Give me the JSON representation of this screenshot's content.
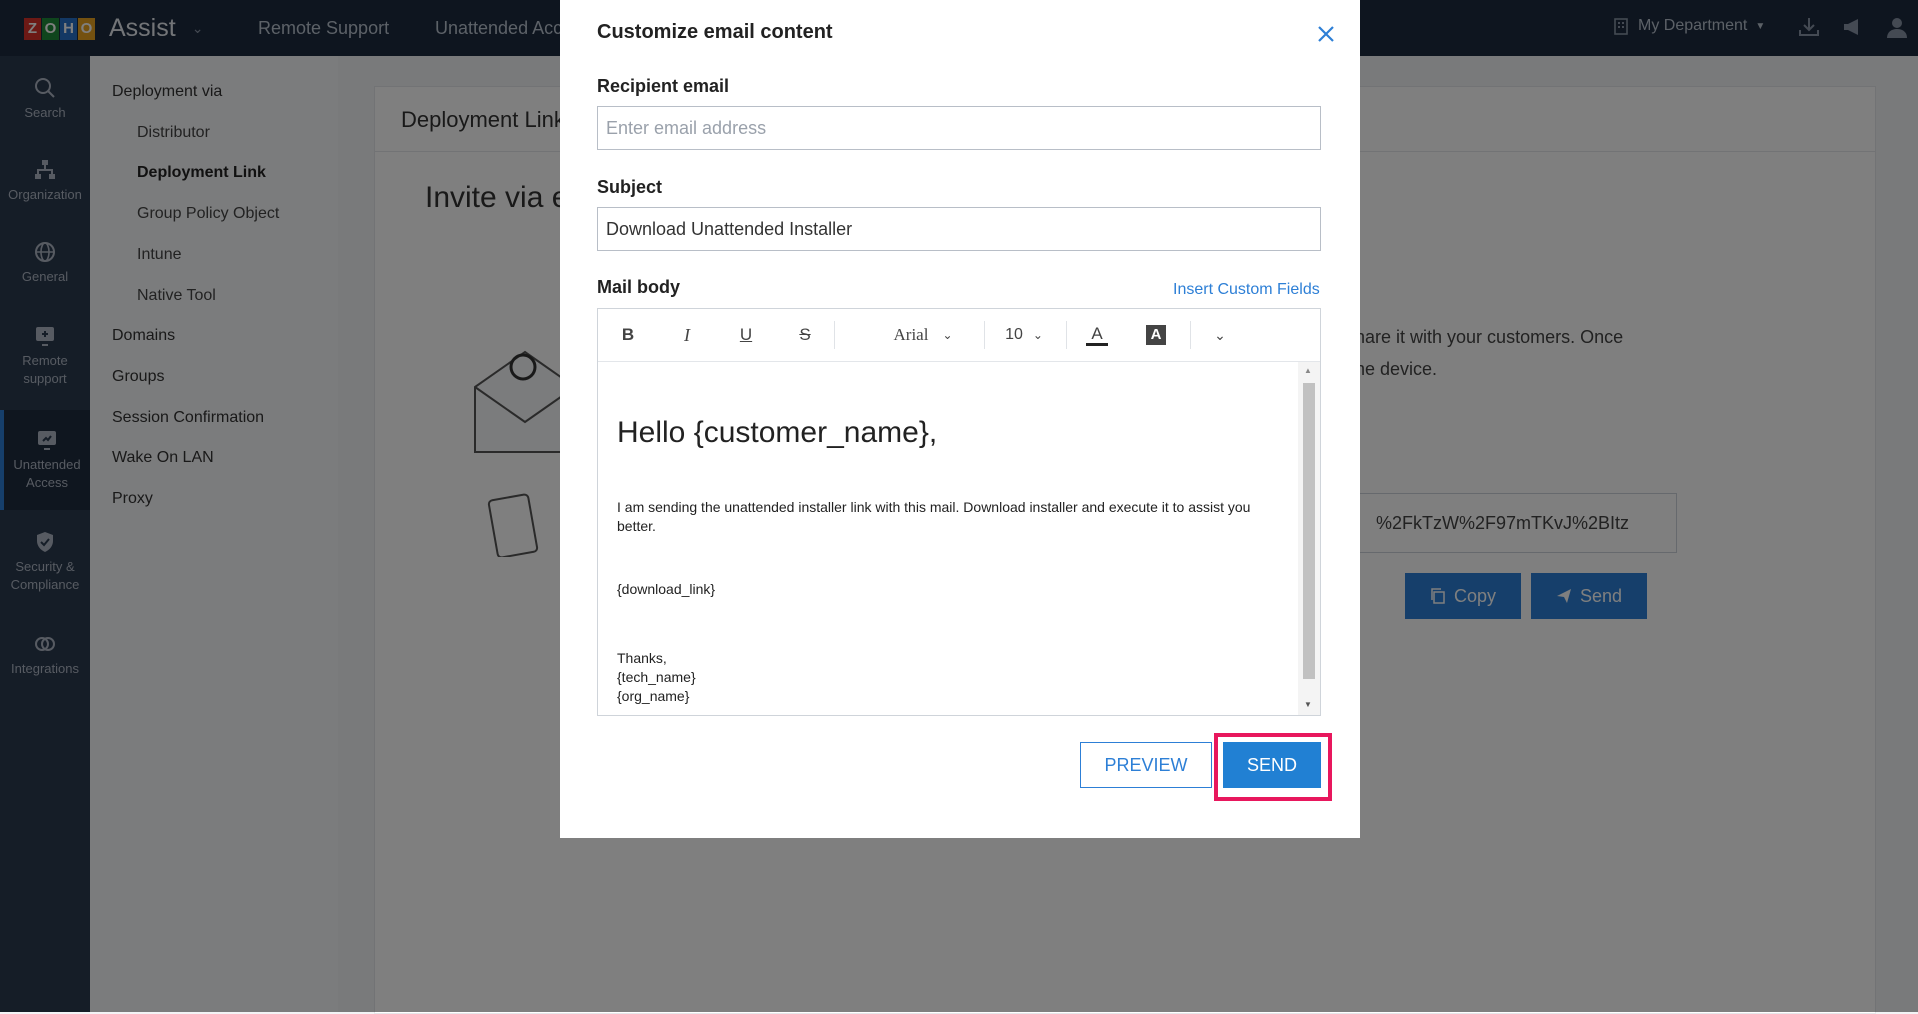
{
  "topbar": {
    "logo_letters": [
      "Z",
      "O",
      "H",
      "O"
    ],
    "app_name": "Assist",
    "nav": [
      "Remote Support",
      "Unattended Access"
    ],
    "department": "My Department"
  },
  "rail": {
    "items": [
      {
        "label": "Search",
        "icon": "search-icon"
      },
      {
        "label": "Organization",
        "icon": "organization-icon"
      },
      {
        "label": "General",
        "icon": "globe-icon"
      },
      {
        "label": "Remote support",
        "icon": "remote-support-icon"
      },
      {
        "label": "Unattended Access",
        "icon": "unattended-access-icon",
        "active": true
      },
      {
        "label": "Security & Compliance",
        "icon": "shield-icon"
      },
      {
        "label": "Integrations",
        "icon": "integrations-icon"
      }
    ]
  },
  "subnav": {
    "items": [
      "Deployment via",
      "Distributor",
      "Deployment Link",
      "Group Policy Object",
      "Intune",
      "Native Tool",
      "Domains",
      "Groups",
      "Session Confirmation",
      "Wake On LAN",
      "Proxy"
    ]
  },
  "main": {
    "card_title": "Deployment Link",
    "invite_title": "Invite via email",
    "desc_line1": "hare it with your customers. Once",
    "desc_line2": "ne device.",
    "link_value": "%2FkTzW%2F97mTKvJ%2BItz",
    "copy_label": "Copy",
    "send_label": "Send"
  },
  "modal": {
    "title": "Customize email content",
    "recipient_label": "Recipient email",
    "recipient_placeholder": "Enter email address",
    "recipient_value": "",
    "subject_label": "Subject",
    "subject_value": "Download Unattended Installer",
    "body_label": "Mail body",
    "insert_fields_label": "Insert Custom Fields",
    "toolbar": {
      "font": "Arial",
      "size": "10"
    },
    "body": {
      "greeting": "Hello {customer_name},",
      "paragraph": "I am sending the unattended installer link with this mail. Download installer and execute it to assist you better.",
      "link_placeholder": "{download_link}",
      "thanks": "Thanks,",
      "tech": "{tech_name}",
      "org": "{org_name}"
    },
    "preview_label": "PREVIEW",
    "send_label": "SEND"
  },
  "colors": {
    "accent": "#2180d3",
    "highlight": "#e8175d",
    "topbar": "#1c2b3f"
  }
}
